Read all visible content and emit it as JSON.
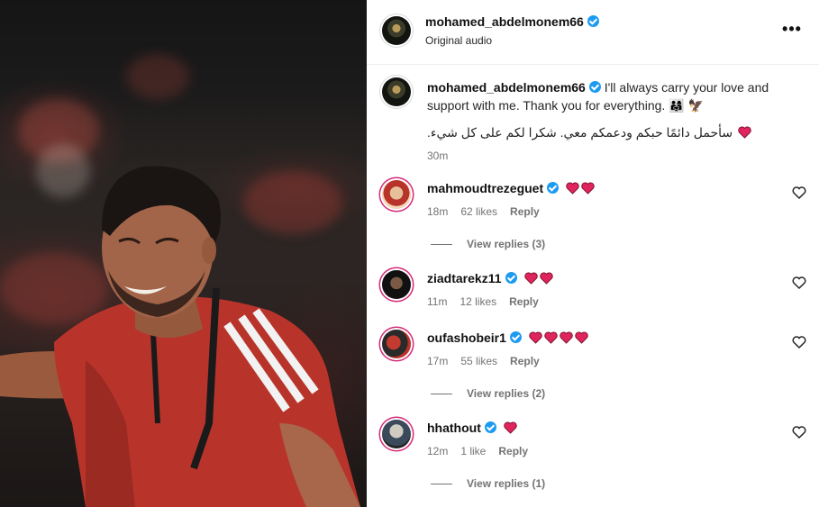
{
  "post": {
    "author": "mohamed_abdelmonem66",
    "audio": "Original audio",
    "more_label": "•••"
  },
  "caption": {
    "username": "mohamed_abdelmonem66",
    "text": "I'll always carry your love and support with me. Thank you for everything.",
    "emojis": "👨‍👩‍👧 🦅",
    "arabic": "سأحمل دائمًا حبكم ودعمكم معي. شكرا لكم على كل شيء.",
    "time": "30m"
  },
  "comments": [
    {
      "username": "mahmoudtrezeguet",
      "hearts": 2,
      "time": "18m",
      "likes": "62 likes",
      "reply": "Reply",
      "view_replies": "View replies (3)"
    },
    {
      "username": "ziadtarekz11",
      "hearts": 2,
      "time": "11m",
      "likes": "12 likes",
      "reply": "Reply",
      "view_replies": ""
    },
    {
      "username": "oufashobeir1",
      "hearts": 4,
      "time": "17m",
      "likes": "55 likes",
      "reply": "Reply",
      "view_replies": "View replies (2)"
    },
    {
      "username": "hhathout",
      "hearts": 1,
      "time": "12m",
      "likes": "1 like",
      "reply": "Reply",
      "view_replies": "View replies (1)"
    }
  ],
  "colors": {
    "verified": "#1d9bf0",
    "heart": "#e0245e",
    "meta_text": "#737373",
    "jersey": "#b8342b"
  },
  "icons": [
    "verified-badge-icon",
    "heart-icon",
    "like-heart-outline-icon",
    "more-options-icon"
  ]
}
